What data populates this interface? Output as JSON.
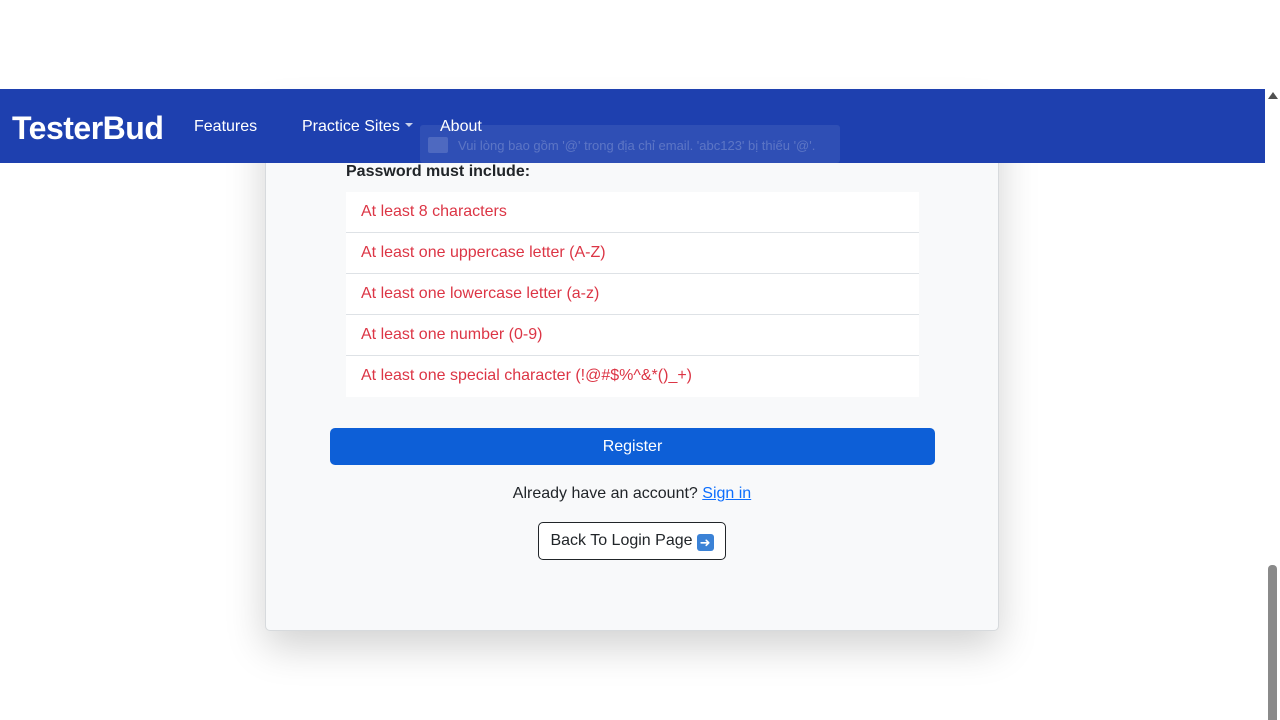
{
  "navbar": {
    "brand": "TesterBud",
    "links": {
      "features": "Features",
      "practice_sites": "Practice Sites",
      "about": "About"
    },
    "background_color": "#1e40af"
  },
  "tooltip": {
    "text": "Vui lòng bao gồm '@' trong địa chỉ email. 'abc123' bị thiếu '@'."
  },
  "form": {
    "password_heading": "Password must include:",
    "requirements": [
      "At least 8 characters",
      "At least one uppercase letter (A-Z)",
      "At least one lowercase letter (a-z)",
      "At least one number (0-9)",
      "At least one special character (!@#$%^&*()_+)"
    ],
    "requirement_color": "#dc3545",
    "register_label": "Register",
    "register_color": "#0d5fd7",
    "signin_prompt": "Already have an account?",
    "signin_link": "Sign in",
    "back_label": "Back To Login Page"
  },
  "icons": {
    "back_arrow": "right-arrow-icon",
    "caret": "chevron-down-icon"
  }
}
